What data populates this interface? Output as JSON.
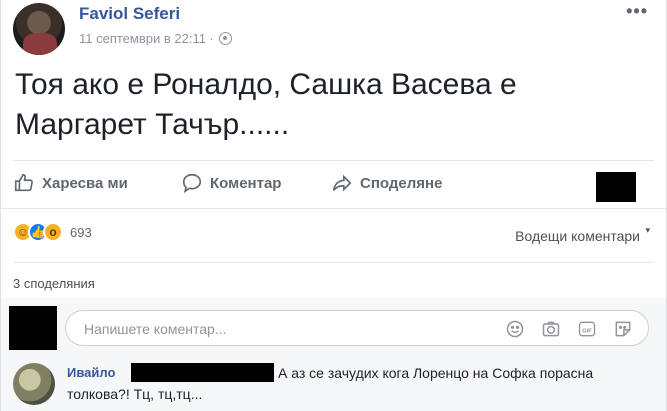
{
  "post": {
    "author": "Faviol Seferi",
    "timestamp": "11 септември в 22:11 ·",
    "more_icon": "•••",
    "text": "Тоя ако е Роналдо, Сашка Васева е Маргарет Тачър......"
  },
  "actions": {
    "like_label": "Харесва ми",
    "comment_label": "Коментар",
    "share_label": "Споделяне"
  },
  "reactions": {
    "count": "693",
    "types": [
      "haha-icon",
      "like-icon",
      "wow-icon"
    ],
    "top_comments": "Водещи коментари"
  },
  "shares": "3 споделяния",
  "comment_box": {
    "placeholder": "Напишете коментар...",
    "tools": [
      "emoji-icon",
      "camera-icon",
      "gif-icon",
      "sticker-icon"
    ]
  },
  "comment": {
    "author": "Ивайло",
    "text_line1": "А аз се зачудих кога Лоренцо на Софка порасна",
    "text_line2": "толкова?! Тц, тц,тц..."
  },
  "colors": {
    "link": "#365899",
    "secondary": "#90949c",
    "text": "#1d2129"
  }
}
